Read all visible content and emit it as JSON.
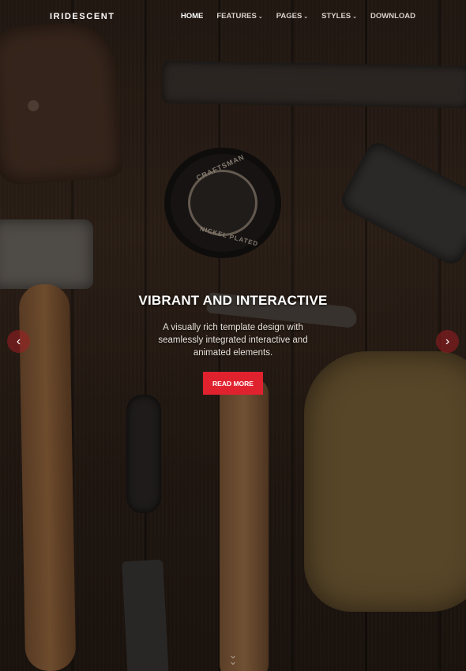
{
  "brand": {
    "name": "IRIDESCENT"
  },
  "nav": {
    "items": [
      {
        "label": "HOME",
        "active": true,
        "dropdown": false
      },
      {
        "label": "FEATURES",
        "active": false,
        "dropdown": true
      },
      {
        "label": "PAGES",
        "active": false,
        "dropdown": true
      },
      {
        "label": "STYLES",
        "active": false,
        "dropdown": true
      },
      {
        "label": "DOWNLOAD",
        "active": false,
        "dropdown": false
      }
    ]
  },
  "hero": {
    "headline": "VIBRANT AND INTERACTIVE",
    "subtext": "A visually rich template design with seamlessly integrated interactive and animated elements.",
    "cta_label": "READ MORE",
    "tape_text_top": "CRAFTSMAN",
    "tape_text_bottom": "NICKEL PLATED",
    "prev_icon": "chevron-left-icon",
    "next_icon": "chevron-right-icon",
    "scroll_icon": "double-chevron-down-icon"
  },
  "colors": {
    "accent": "#e0222f",
    "text": "#ffffff"
  }
}
